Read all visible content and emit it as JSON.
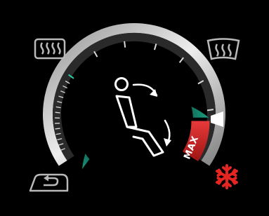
{
  "screen": {
    "title": "",
    "background": "#000000"
  },
  "fan_dial": {
    "level": 0.87,
    "max_label": "MAX",
    "active_color": "#1fb08c",
    "active_dark_color": "#0b3a32",
    "max_zone_color": "#d92626",
    "bezel_color": "#c8c8c8",
    "pointer_color": "#ffffff"
  },
  "icons": {
    "rear_defrost": {
      "name": "rear-defrost-icon",
      "color": "#b9b9b9"
    },
    "front_defrost": {
      "name": "front-defrost-icon",
      "color": "#b9b9b9"
    },
    "recirculation": {
      "name": "recirculation-icon",
      "color": "#b9b9b9"
    },
    "ac_max": {
      "name": "snowflake-icon",
      "color": "#e52521"
    },
    "seat_airflow": {
      "name": "seat-airflow-icon",
      "color": "#ffffff"
    }
  }
}
